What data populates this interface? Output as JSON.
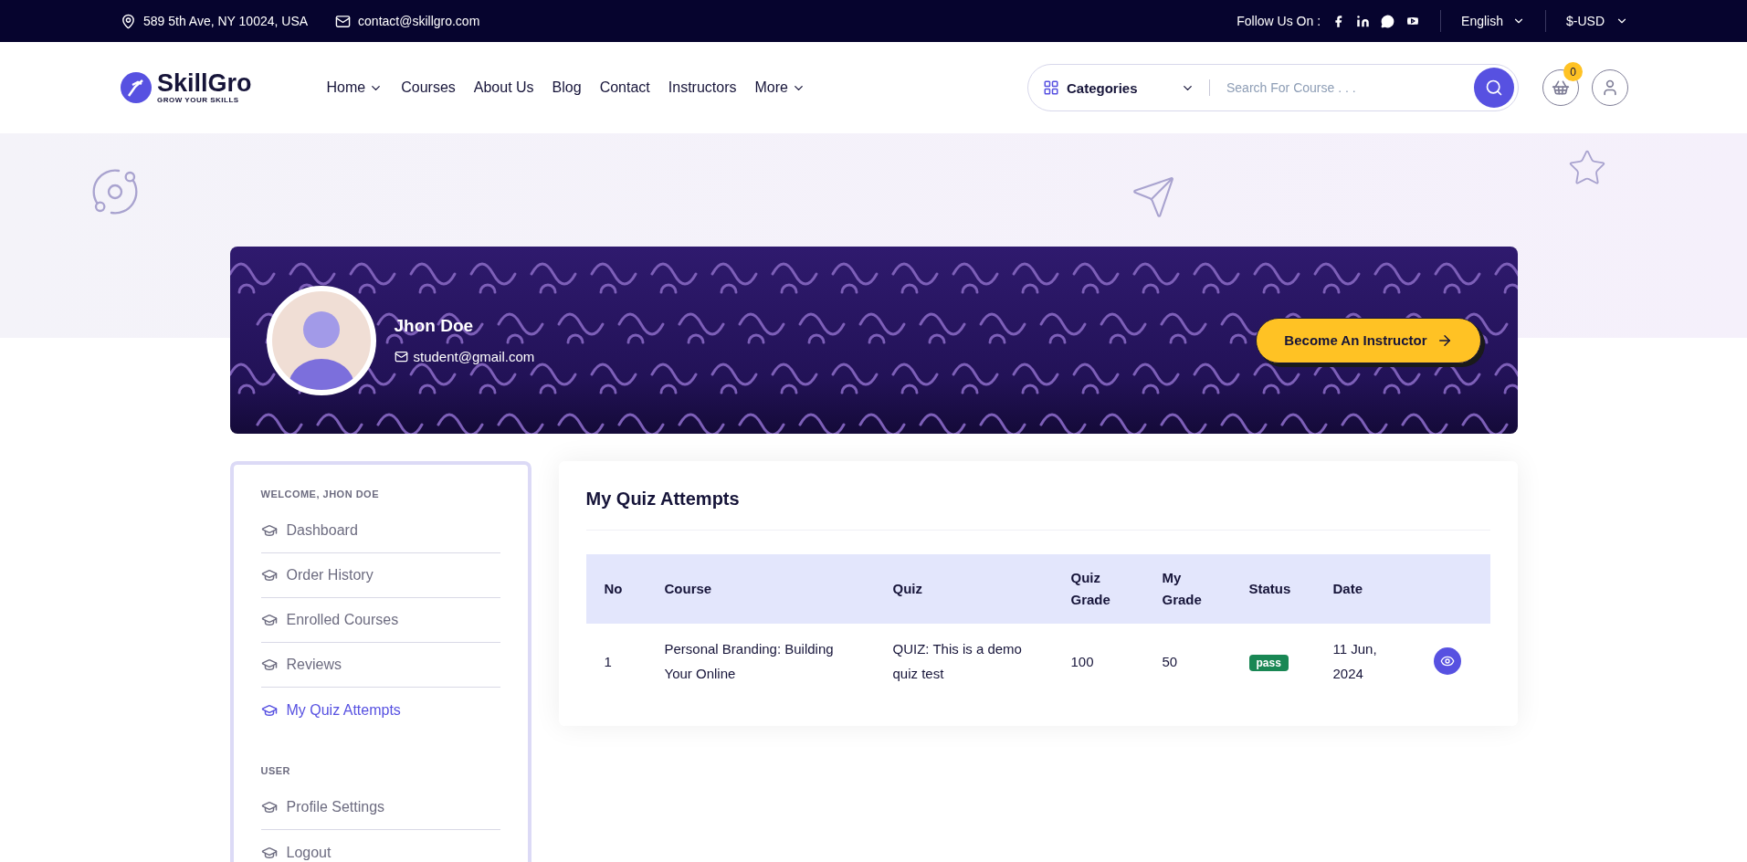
{
  "top_bar": {
    "address": "589 5th Ave, NY 10024, USA",
    "email": "contact@skillgro.com",
    "follow_label": "Follow Us On :",
    "language": "English",
    "currency": "$-USD"
  },
  "header": {
    "logo": {
      "name": "SkillGro",
      "tagline": "GROW YOUR SKILLS"
    },
    "nav": [
      {
        "label": "Home",
        "dropdown": true
      },
      {
        "label": "Courses",
        "dropdown": false
      },
      {
        "label": "About Us",
        "dropdown": false
      },
      {
        "label": "Blog",
        "dropdown": false
      },
      {
        "label": "Contact",
        "dropdown": false
      },
      {
        "label": "Instructors",
        "dropdown": false
      },
      {
        "label": "More",
        "dropdown": true
      }
    ],
    "categories": "Categories",
    "search": {
      "placeholder": "Search For Course . . ."
    },
    "cart_count": "0"
  },
  "profile": {
    "name": "Jhon Doe",
    "email": "student@gmail.com",
    "button": "Become An Instructor"
  },
  "sidebar": {
    "sections": [
      {
        "title": "WELCOME, JHON DOE",
        "items": [
          {
            "label": "Dashboard",
            "selected": false
          },
          {
            "label": "Order History",
            "selected": false
          },
          {
            "label": "Enrolled Courses",
            "selected": false
          },
          {
            "label": "Reviews",
            "selected": false
          },
          {
            "label": "My Quiz Attempts",
            "selected": true
          }
        ]
      },
      {
        "title": "USER",
        "items": [
          {
            "label": "Profile Settings",
            "selected": false
          },
          {
            "label": "Logout",
            "selected": false
          }
        ]
      }
    ]
  },
  "content": {
    "title": "My Quiz Attempts",
    "table": {
      "columns": [
        "No",
        "Course",
        "Quiz",
        "Quiz Grade",
        "My Grade",
        "Status",
        "Date"
      ],
      "rows": [
        {
          "no": "1",
          "course": "Personal Branding: Building Your Online",
          "quiz": "QUIZ: This is a demo quiz test",
          "quiz_grade": "100",
          "my_grade": "50",
          "status": "pass",
          "date": "11 Jun, 2024"
        }
      ]
    }
  }
}
